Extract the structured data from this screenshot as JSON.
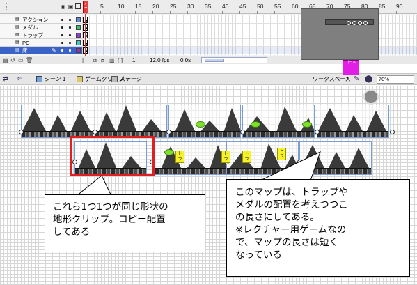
{
  "timeline": {
    "ruler_numbers": [
      "1",
      "5",
      "10",
      "15",
      "20",
      "25",
      "30",
      "35",
      "40",
      "45",
      "50",
      "55",
      "60",
      "65",
      "70",
      "75",
      "80",
      "85",
      "90"
    ],
    "playhead_frame": "1",
    "header_icons": [
      "eye-icon",
      "lock-icon",
      "outline-icon"
    ],
    "layers": [
      {
        "name": "アクション",
        "color": "#5b8dd8",
        "selected": false
      },
      {
        "name": "メダル",
        "color": "#39c26a",
        "selected": false
      },
      {
        "name": "トラップ",
        "color": "#8a3fd0",
        "selected": false
      },
      {
        "name": "PC",
        "color": "#3dc9c4",
        "selected": false
      },
      {
        "name": "床",
        "color": "#9a2fb8",
        "selected": true
      }
    ],
    "current_frame": "1",
    "fps": "12.0 fps",
    "time": "0.0s"
  },
  "editbar": {
    "scene": "シーン 1",
    "movie_clip": "ゲームクリップ",
    "stage": "ステージ",
    "workspace": "ワークスペース",
    "zoom": "70%"
  },
  "stage": {
    "trap_label": "トラップ",
    "medal_label": "メダル",
    "goal_label": "ゴール"
  },
  "callouts": {
    "left": [
      "これら1つ1つが同じ形状の",
      "地形クリップ。コピー配置",
      "してある"
    ],
    "right": [
      "このマップは、トラップや",
      "メダルの配置を考えつつこ",
      "の長さにしてある。",
      "※レクチャー用ゲームなの",
      "で、マップの長さは短く",
      "なっている"
    ]
  },
  "colors": {
    "highlight_box": "#e02020",
    "selected_layer": "#3a63c8",
    "tile_border": "#7a9dd6",
    "trap": "#f5f228",
    "medal": "#7fe02a",
    "goal": "#e21de6"
  }
}
